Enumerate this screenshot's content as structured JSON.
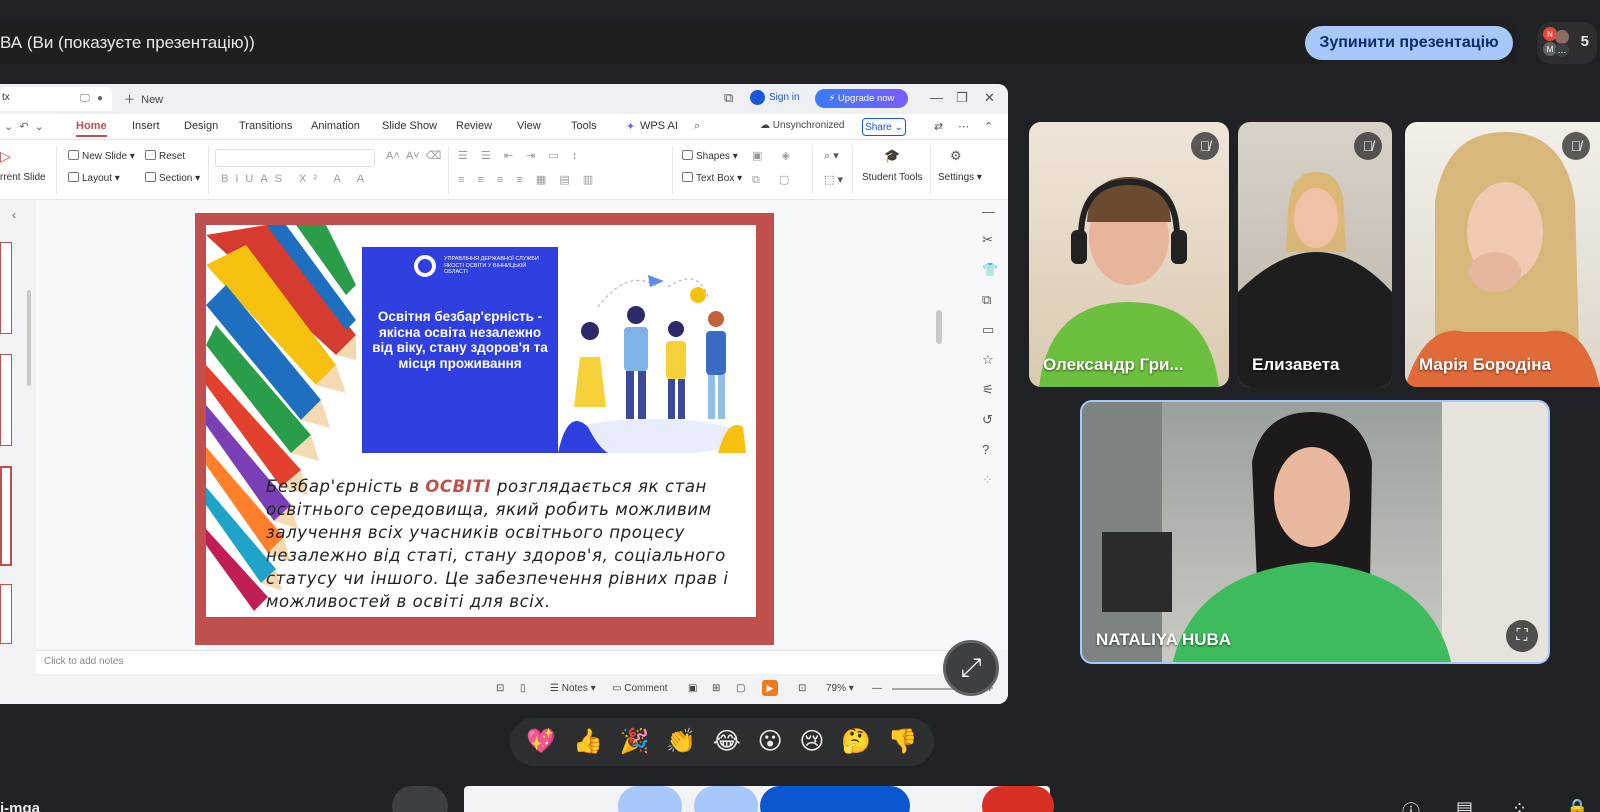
{
  "meet": {
    "title": "ВА (Ви (показуєте презентацію))",
    "stop_button": "Зупинити презентацію",
    "participant_count": "5",
    "meeting_code_fragment": "i-mqa"
  },
  "wps": {
    "doc_tab": "tx",
    "new_tab": "New",
    "sign_in": "Sign in",
    "upgrade": "Upgrade now",
    "menu": [
      "Home",
      "Insert",
      "Design",
      "Transitions",
      "Animation",
      "Slide Show",
      "Review",
      "View",
      "Tools"
    ],
    "wps_ai": "WPS AI",
    "unsync": "Unsynchronized",
    "share": "Share",
    "ribbon": {
      "current_slide": "rrent Slide",
      "new_slide": "New Slide",
      "reset": "Reset",
      "layout": "Layout",
      "section": "Section",
      "shapes": "Shapes",
      "text_box": "Text Box",
      "student_tools": "Student Tools",
      "settings": "Settings"
    },
    "notes_placeholder": "Click to add notes",
    "status": {
      "notes": "Notes",
      "comment": "Comment",
      "zoom": "79%"
    }
  },
  "slide": {
    "org_name": "УПРАВЛІННЯ ДЕРЖАВНОЇ СЛУЖБИ ЯКОСТІ ОСВІТИ У ВІННИЦЬКІЙ ОБЛАСТІ",
    "heading": "Освітня безбар'єрність - якісна освіта незалежно від віку, стану здоров'я та місця проживання",
    "body_before": "Безбар'єрність в ",
    "body_highlight": "ОСВІТІ",
    "body_after": " розглядається як стан освітнього середовища, який робить можливим залучення всіх учасників освітнього процесу незалежно від статі, стану здоров'я, соціального статусу чи іншого. Це забезпечення рівних прав і можливостей в освіті для всіх."
  },
  "participants": [
    {
      "name": "Олександр Гри...",
      "muted": true
    },
    {
      "name": "Елизавета",
      "muted": true
    },
    {
      "name": "Марія Бородіна",
      "muted": true
    },
    {
      "name": "NATALIYA HUBA",
      "muted": false
    }
  ],
  "reactions": [
    "💖",
    "👍",
    "🎉",
    "👏",
    "😂",
    "😮",
    "😢",
    "🤔",
    "👎"
  ],
  "colors": {
    "accent": "#a8c7fa",
    "slide_frame": "#c0504d",
    "slide_blue": "#2f3fe0",
    "wps_active": "#c0504d"
  }
}
